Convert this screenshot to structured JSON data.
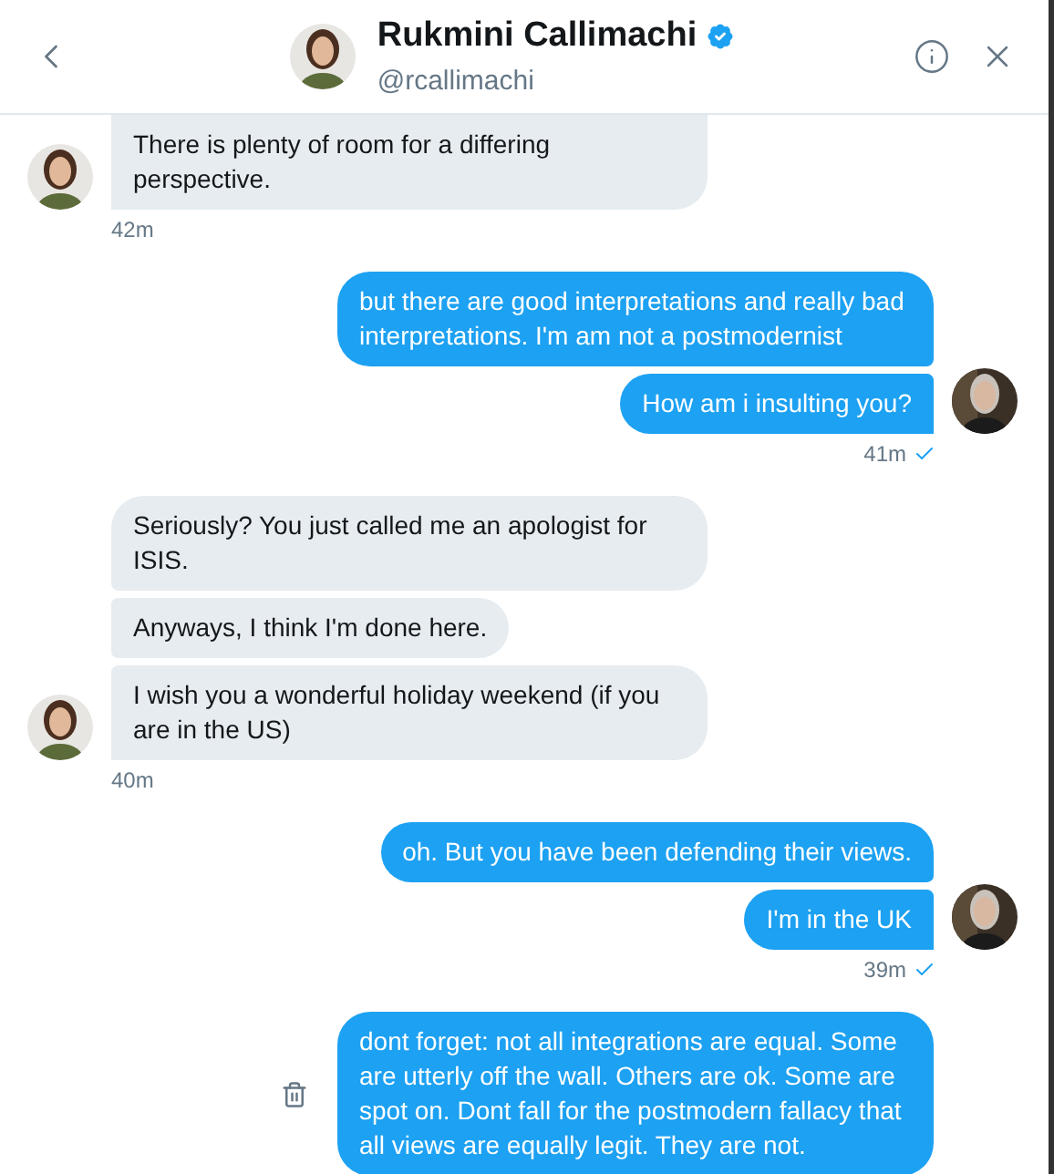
{
  "header": {
    "name": "Rukmini Callimachi",
    "verified": true,
    "handle": "@rcallimachi"
  },
  "groups": [
    {
      "kind": "them",
      "messages": [
        "There is plenty of room for a differing perspective."
      ],
      "time": "42m",
      "cut_top": true
    },
    {
      "kind": "me",
      "messages": [
        "but there are good interpretations and really bad interpretations. I'm am not a postmodernist",
        "How am i insulting you?"
      ],
      "time": "41m",
      "read": true
    },
    {
      "kind": "them",
      "messages": [
        "Seriously? You just called me an apologist for ISIS.",
        "Anyways, I think I'm done here.",
        "I wish you a wonderful holiday weekend (if you are in the US)"
      ],
      "time": "40m"
    },
    {
      "kind": "me",
      "messages": [
        "oh. But you have been defending their views.",
        "I'm in the UK"
      ],
      "time": "39m",
      "read": true
    },
    {
      "kind": "me",
      "messages": [
        "dont forget: not all integrations are equal. Some are utterly off the wall. Others are ok. Some are spot on. Dont fall for the postmodern fallacy that all views are equally legit. They are not."
      ],
      "deletable": true
    }
  ]
}
